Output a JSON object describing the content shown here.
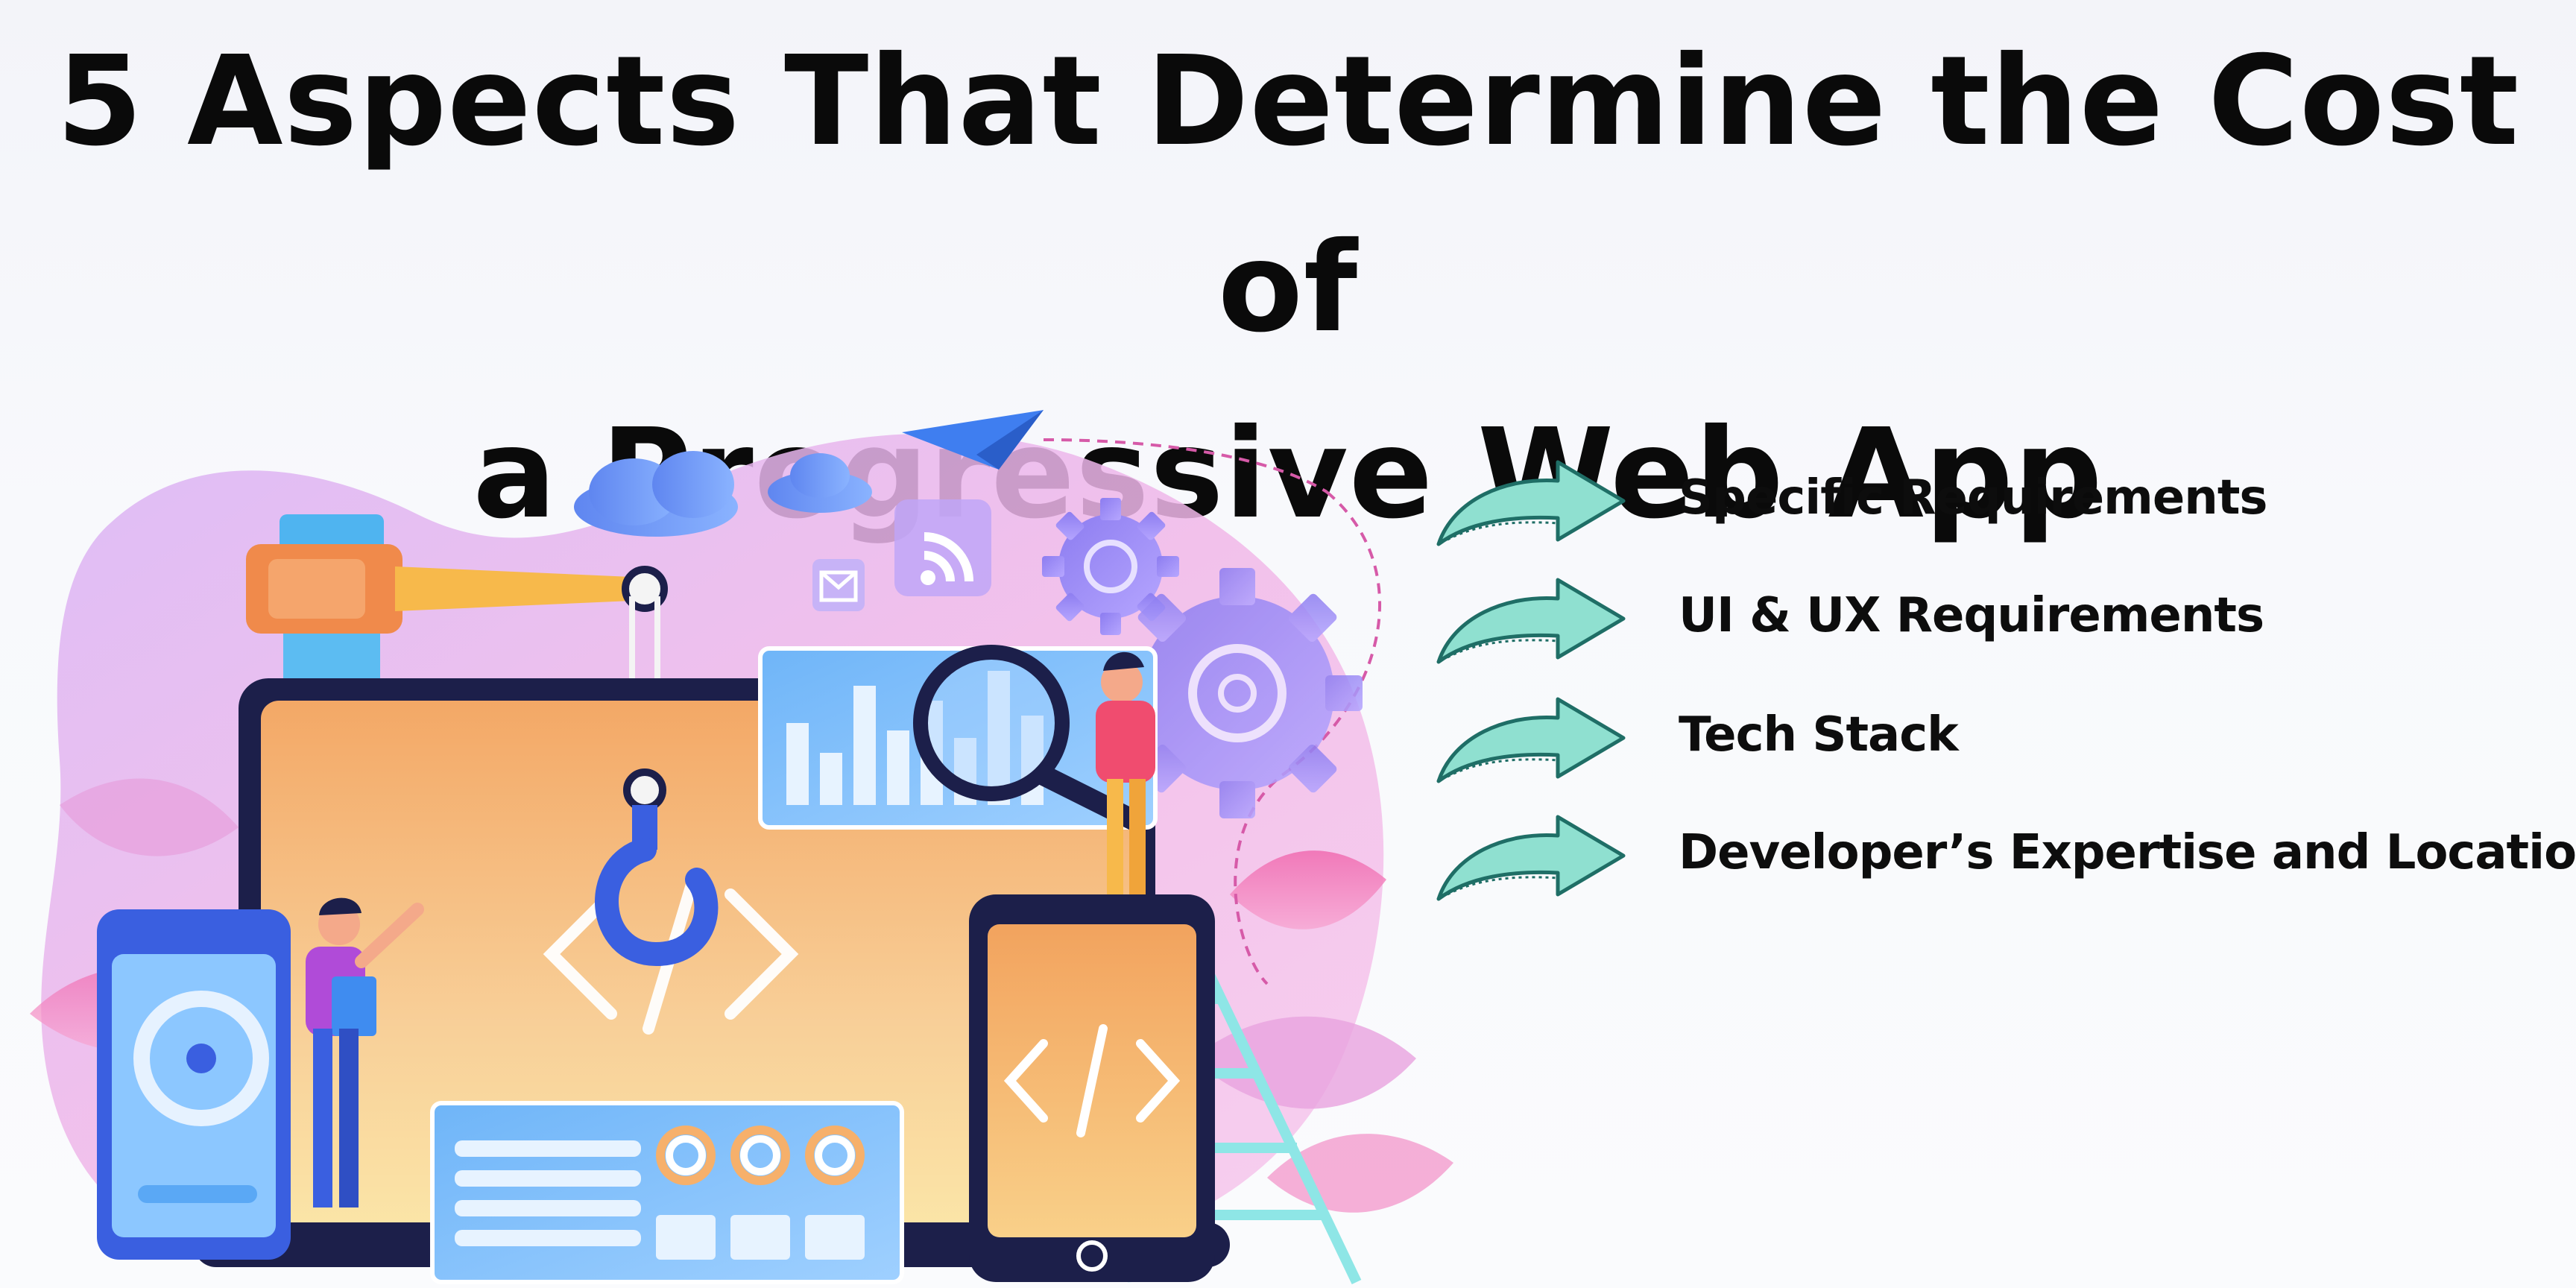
{
  "title": {
    "line1": "5 Aspects That Determine the Cost of",
    "line2": "a Progressive Web App"
  },
  "aspects": [
    {
      "label": "Specific Requirements",
      "icon": "curved-arrow-icon"
    },
    {
      "label": "UI & UX Requirements",
      "icon": "curved-arrow-icon"
    },
    {
      "label": "Tech Stack",
      "icon": "curved-arrow-icon"
    },
    {
      "label": "Developer’s Expertise and Location",
      "icon": "curved-arrow-icon"
    }
  ],
  "colors": {
    "arrow_fill": "#8fe0d0",
    "arrow_stroke": "#1f6e66",
    "title_text": "#0a0a0a",
    "blob_pink": "#f3b3e6",
    "blob_purple": "#c9a0f2",
    "screen_orange": "#f6b46a",
    "frame_navy": "#1c1f4a",
    "accent_blue": "#5aa8f5"
  },
  "illustration": {
    "description_icon": "web-development-illustration"
  }
}
